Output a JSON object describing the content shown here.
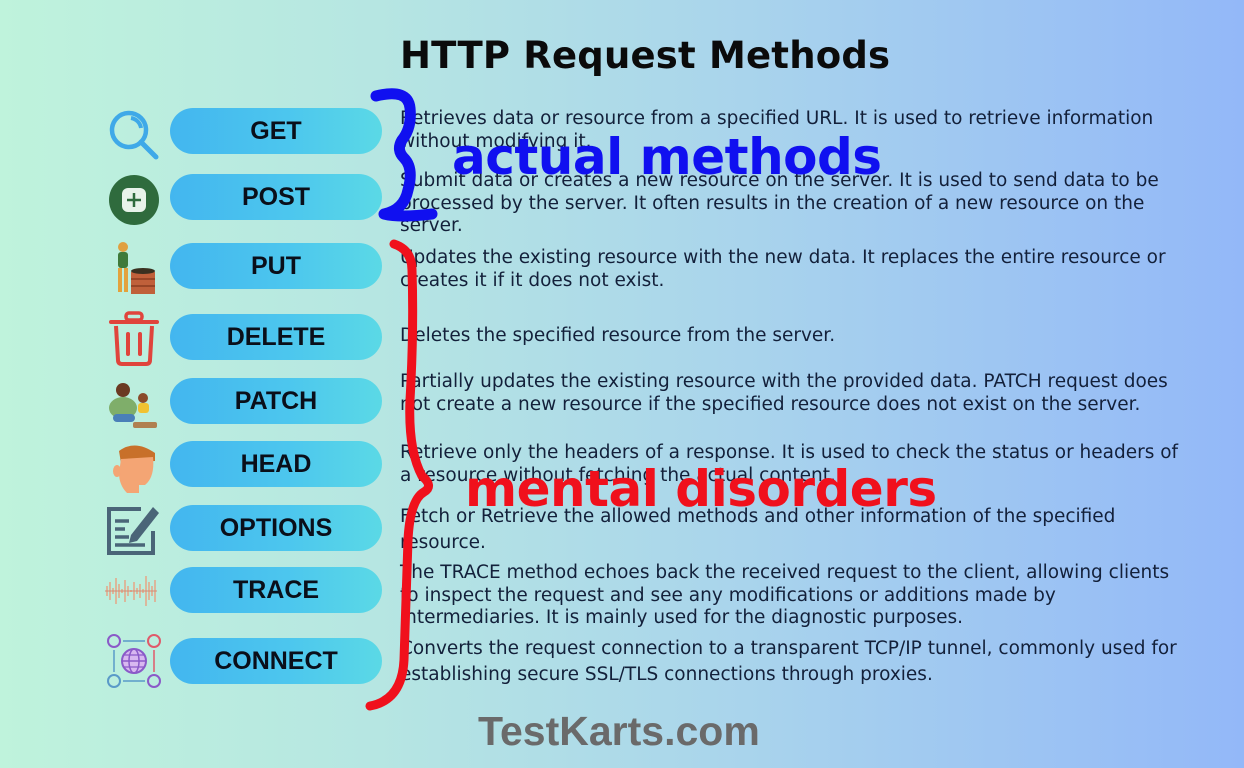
{
  "title": "HTTP Request Methods",
  "methods": [
    {
      "name": "GET",
      "icon": "magnifier-icon",
      "description": "Retrieves data or resource from a specified URL. It is used to retrieve information without modifying it."
    },
    {
      "name": "POST",
      "icon": "plus-square-icon",
      "description": "Submit data or creates a new resource on the server. It is used to send data to be processed by the server. It often results in the creation of a new resource on the server."
    },
    {
      "name": "PUT",
      "icon": "gardener-icon",
      "description": "Updates the existing resource with the new data. It replaces the entire resource or creates it if it does not exist."
    },
    {
      "name": "DELETE",
      "icon": "trash-icon",
      "description": "Deletes the specified resource from the server."
    },
    {
      "name": "PATCH",
      "icon": "parent-child-icon",
      "description": "Partially updates the existing resource with the provided data. PATCH request does not create a new resource if the specified resource does not exist on the server."
    },
    {
      "name": "HEAD",
      "icon": "head-icon",
      "description": "Retrieve only the headers of a response. It is used to check the status or headers of a resource without fetching the actual content."
    },
    {
      "name": "OPTIONS",
      "icon": "edit-document-icon",
      "description": "Fetch or Retrieve the allowed methods and other information of the specified resource."
    },
    {
      "name": "TRACE",
      "icon": "waveform-icon",
      "description": "The TRACE method echoes back the received request to the client, allowing clients to inspect the request and see any modifications or additions made by intermediaries. It is mainly used for the diagnostic purposes."
    },
    {
      "name": "CONNECT",
      "icon": "network-globe-icon",
      "description": "Converts the request connection to a transparent TCP/IP tunnel, commonly used for establishing secure SSL/TLS connections through proxies."
    }
  ],
  "annotations": {
    "blue_label": "actual methods",
    "red_label": "mental disorders",
    "blue_color": "#1010f0",
    "red_color": "#f0101c"
  },
  "footer": "TestKarts.com"
}
